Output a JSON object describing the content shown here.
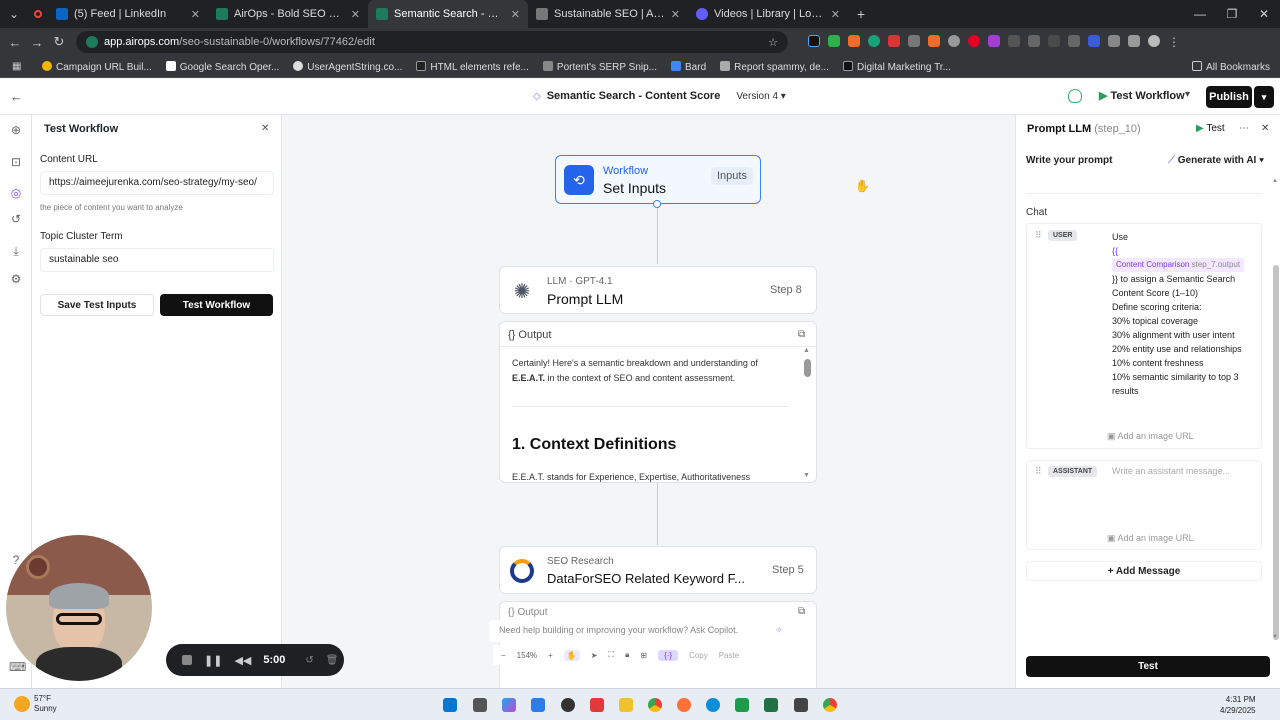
{
  "browser": {
    "tabs": [
      {
        "title": "(5) Feed | LinkedIn",
        "color": "#0a66c2"
      },
      {
        "title": "AirOps - Bold SEO Strategies ru",
        "color": "#1f7a5c"
      },
      {
        "title": "Semantic Search - Content",
        "color": "#1f7a5c"
      },
      {
        "title": "Sustainable SEO | Aimee Jurenk",
        "color": "#777777"
      },
      {
        "title": "Videos | Library | Loom",
        "color": "#625df5"
      }
    ],
    "url_host": "app.airops.com",
    "url_path": "/seo-sustainable-0/workflows/77462/edit",
    "bookmarks": [
      "Campaign URL Buil...",
      "Google Search Oper...",
      "UserAgentString.co...",
      "HTML elements refe...",
      "Portent's SERP Snip...",
      "Bard",
      "Report spammy, de...",
      "Digital Marketing Tr..."
    ],
    "all_bookmarks": "All Bookmarks"
  },
  "header": {
    "title": "Semantic Search - Content Score",
    "version": "Version 4",
    "test_workflow": "Test Workflow",
    "publish": "Publish"
  },
  "left_panel": {
    "title": "Test Workflow",
    "content_url_label": "Content URL",
    "content_url_value": "https://aimeejurenka.com/seo-strategy/my-seo/",
    "content_url_hint": "the piece of content you want to analyze",
    "topic_label": "Topic Cluster Term",
    "topic_value": "sustainable seo",
    "save_btn": "Save Test Inputs",
    "test_btn": "Test Workflow"
  },
  "canvas": {
    "inputs_node": {
      "kicker": "Workflow",
      "title": "Set Inputs",
      "badge": "Inputs"
    },
    "llm_node": {
      "kicker": "LLM · GPT-4.1",
      "title": "Prompt LLM",
      "step": "Step 8",
      "output_label": "Output",
      "output_p1": "Certainly! Here's a semantic breakdown and understanding of",
      "output_p1b": "E.E.A.T.",
      "output_p1c": " in the context of SEO and content assessment.",
      "output_h": "1. Context Definitions",
      "output_p2": "E.E.A.T. stands for Experience, Expertise, Authoritativeness"
    },
    "seo_node": {
      "kicker": "SEO Research",
      "title": "DataForSEO Related Keyword F...",
      "step": "Step 5",
      "output_label": "Output"
    },
    "copilot_placeholder": "Need help building or improving your workflow? Ask Copilot.",
    "zoom": "154%",
    "copy": "Copy",
    "paste": "Paste"
  },
  "right_panel": {
    "title": "Prompt LLM",
    "step_id": "(step_10)",
    "test": "Test",
    "write_prompt": "Write your prompt",
    "generate": "Generate with AI",
    "chat_label": "Chat",
    "user_role": "USER",
    "user_lines": [
      "Use",
      "{{",
      "}} to assign a Semantic Search",
      "Content Score (1–10)",
      "Define scoring criteria:",
      "30% topical coverage",
      "30% alignment with user intent",
      "20% entity use and relationships",
      "10% content freshness",
      "10% semantic similarity to top 3",
      "results"
    ],
    "var_name": "Content Comparison",
    "var_ref": "step_7.output",
    "add_image": "Add an image URL",
    "assistant_role": "ASSISTANT",
    "assistant_placeholder": "Write an assistant message...",
    "add_message": "+ Add Message",
    "test_btn": "Test"
  },
  "recorder": {
    "time": "5:00"
  },
  "taskbar": {
    "temp": "57°F",
    "weather": "Sunny",
    "time": "4:31 PM",
    "date": "4/29/2025"
  }
}
